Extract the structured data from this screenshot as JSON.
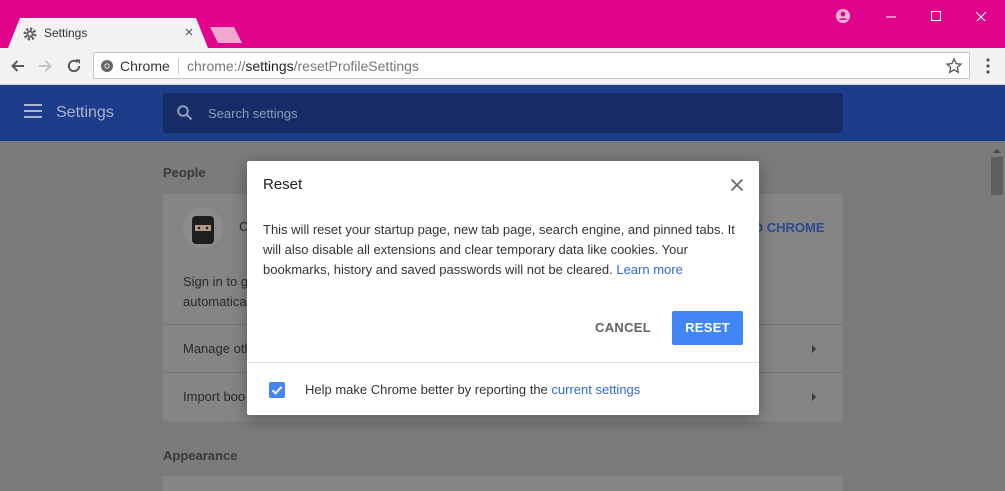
{
  "colors": {
    "titlebar": "#e0048c",
    "settings_header": "#1d3c89",
    "accent": "#4285f4",
    "link": "#3367d6"
  },
  "tab": {
    "title": "Settings",
    "icon": "gear-icon",
    "close_glyph": "×"
  },
  "toolbar": {
    "chip_label": "Chrome",
    "url_prefix": "chrome://",
    "url_host": "settings",
    "url_path": "/resetProfileSettings"
  },
  "header": {
    "title": "Settings",
    "search_placeholder": "Search settings"
  },
  "page": {
    "people_title": "People",
    "people_row1_partial": "C",
    "signin_link_partial": "O CHROME",
    "signin_text_line1": "Sign in to g",
    "signin_text_line2": "automatica",
    "manage_row": "Manage oth",
    "import_row": "Import boo",
    "appearance_title": "Appearance"
  },
  "dialog": {
    "title": "Reset",
    "body_text": "This will reset your startup page, new tab page, search engine, and pinned tabs. It will also disable all extensions and clear temporary data like cookies. Your bookmarks, history and saved passwords will not be cleared. ",
    "learn_more": "Learn more",
    "cancel_label": "CANCEL",
    "reset_label": "RESET",
    "checkbox_checked": true,
    "checkbox_text": "Help make Chrome better by reporting the ",
    "checkbox_link": "current settings"
  }
}
